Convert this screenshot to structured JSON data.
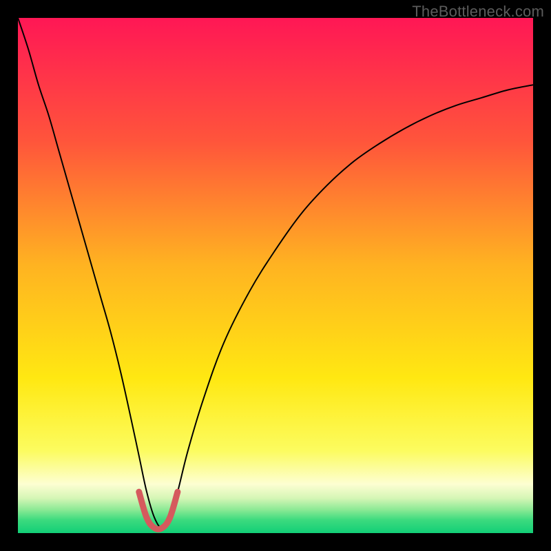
{
  "watermark": "TheBottleneck.com",
  "chart_data": {
    "type": "line",
    "title": "",
    "xlabel": "",
    "ylabel": "",
    "xlim": [
      0,
      100
    ],
    "ylim": [
      0,
      100
    ],
    "axes": {
      "visible": false,
      "grid": false,
      "ticks": []
    },
    "background": {
      "type": "vertical-gradient",
      "stops": [
        {
          "pos": 0.0,
          "color": "#ff1755"
        },
        {
          "pos": 0.24,
          "color": "#ff553b"
        },
        {
          "pos": 0.48,
          "color": "#ffb321"
        },
        {
          "pos": 0.7,
          "color": "#ffe812"
        },
        {
          "pos": 0.84,
          "color": "#fcfc5f"
        },
        {
          "pos": 0.905,
          "color": "#fdfed2"
        },
        {
          "pos": 0.932,
          "color": "#d6f6b6"
        },
        {
          "pos": 0.955,
          "color": "#8ae994"
        },
        {
          "pos": 0.975,
          "color": "#3bda7e"
        },
        {
          "pos": 1.0,
          "color": "#12cf77"
        }
      ]
    },
    "series": [
      {
        "name": "bottleneck-curve",
        "stroke": "#000000",
        "stroke_width": 2,
        "x": [
          0,
          2,
          4,
          6,
          8,
          10,
          12,
          14,
          16,
          18,
          20,
          22,
          23.5,
          25,
          26.5,
          28,
          29.5,
          31,
          33,
          36,
          40,
          45,
          50,
          55,
          60,
          65,
          70,
          75,
          80,
          85,
          90,
          95,
          100
        ],
        "y": [
          100,
          94,
          87,
          81,
          74,
          67,
          60,
          53,
          46,
          39,
          31,
          22,
          15,
          8,
          3,
          1,
          3,
          8,
          16,
          26,
          37,
          47,
          55,
          62,
          67.5,
          72,
          75.5,
          78.5,
          81,
          83,
          84.5,
          86,
          87
        ]
      },
      {
        "name": "valley-highlight",
        "stroke": "#d55a5d",
        "stroke_width": 9,
        "linecap": "round",
        "x": [
          23.5,
          25,
          26.5,
          28,
          29.5,
          31
        ],
        "y": [
          8,
          3,
          1,
          1,
          3,
          8
        ]
      }
    ],
    "minimum": {
      "x": 27.3,
      "y": 0.8
    }
  }
}
